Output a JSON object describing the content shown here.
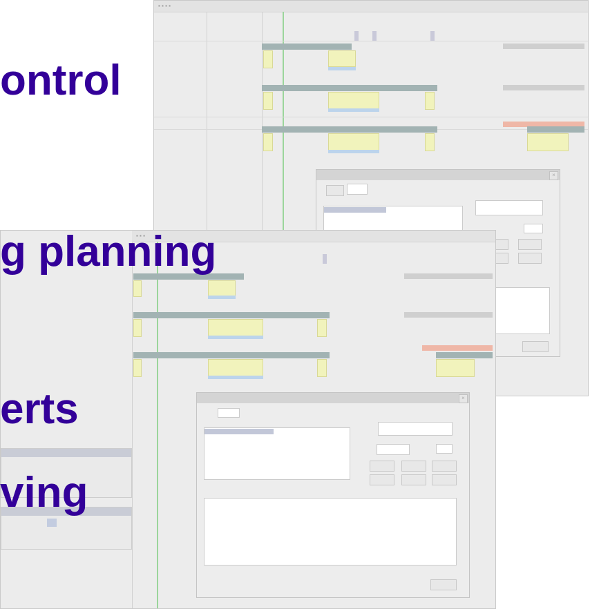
{
  "slide": {
    "headings": [
      "ontrol",
      "g planning",
      "erts",
      "ving"
    ],
    "heading_color": "#330099"
  }
}
